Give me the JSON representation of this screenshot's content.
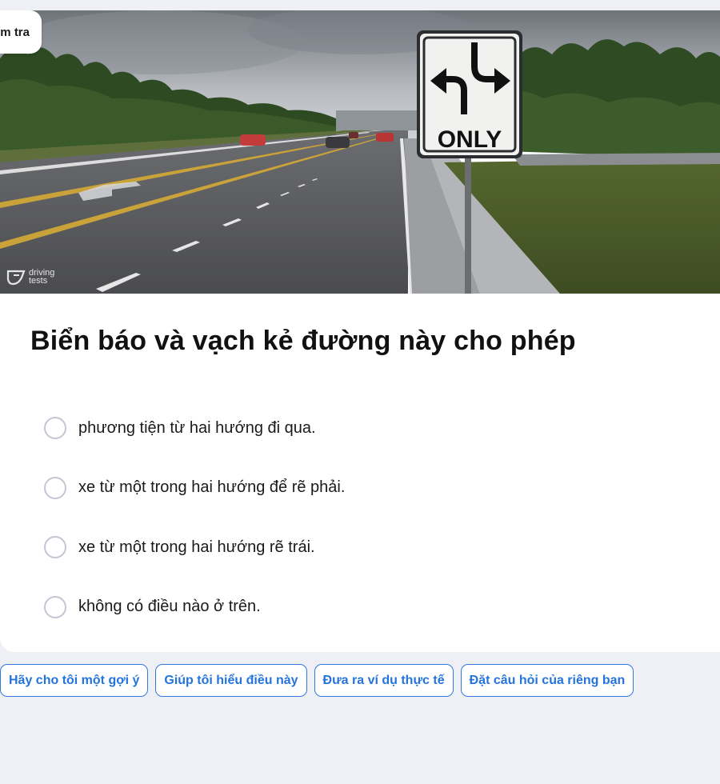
{
  "badge": {
    "label": "Kiểm tra"
  },
  "scene": {
    "sign_text": "ONLY",
    "watermark": {
      "line1": "driving",
      "line2": "tests"
    }
  },
  "question": {
    "text": "Biển báo và vạch kẻ đường này cho phép"
  },
  "options": [
    {
      "label": "phương tiện từ hai hướng đi qua."
    },
    {
      "label": "xe từ một trong hai hướng để rẽ phải."
    },
    {
      "label": "xe từ một trong hai hướng rẽ trái."
    },
    {
      "label": "không có điều nào ở trên."
    }
  ],
  "suggestions": [
    {
      "label": "Hãy cho tôi một gợi ý"
    },
    {
      "label": "Giúp tôi hiểu điều này"
    },
    {
      "label": "Đưa ra ví dụ thực tế"
    },
    {
      "label": "Đặt câu hỏi của riêng bạn"
    }
  ],
  "colors": {
    "page_bg": "#eff0f6",
    "card_bg": "#ffffff",
    "accent": "#2574dd",
    "radio_border": "#c4c6d3"
  }
}
